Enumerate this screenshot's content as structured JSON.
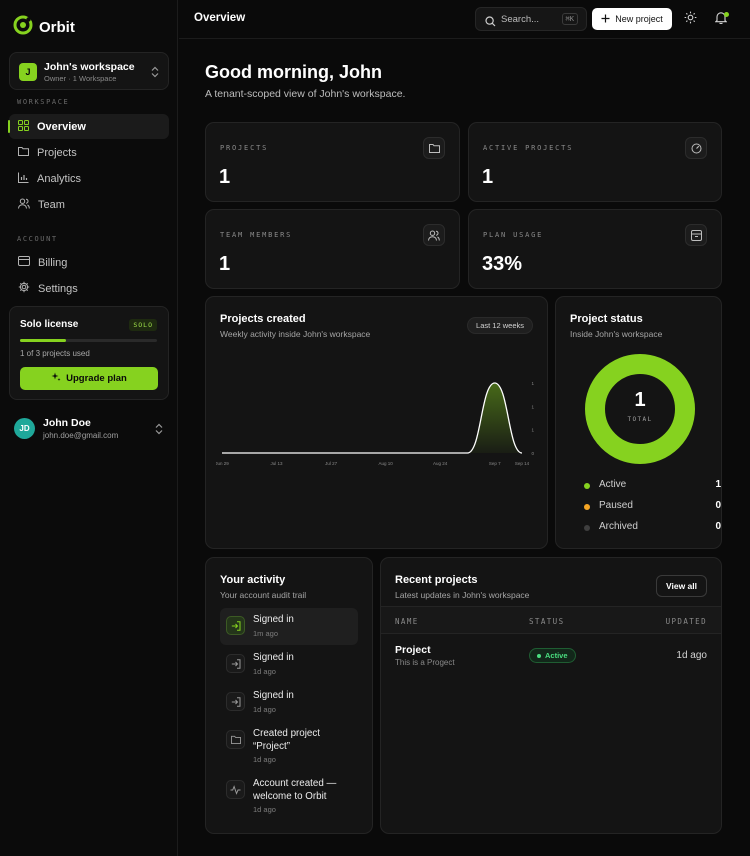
{
  "brand": {
    "name": "Orbit",
    "accent": "#86d21f"
  },
  "workspace": {
    "initial": "J",
    "name": "John's workspace",
    "meta": "Owner · 1 Workspace"
  },
  "sidebar": {
    "workspace_label": "WORKSPACE",
    "account_label": "ACCOUNT",
    "items": [
      {
        "label": "Overview",
        "icon": "grid-icon",
        "active": true
      },
      {
        "label": "Projects",
        "icon": "folder-icon"
      },
      {
        "label": "Analytics",
        "icon": "bar-chart-icon"
      },
      {
        "label": "Team",
        "icon": "users-icon"
      },
      {
        "label": "Billing",
        "icon": "credit-card-icon"
      },
      {
        "label": "Settings",
        "icon": "gear-icon"
      }
    ]
  },
  "license": {
    "title": "Solo license",
    "badge": "SOLO",
    "usage_text": "1 of 3 projects used",
    "usage_fraction": 0.333,
    "upgrade_label": "Upgrade plan"
  },
  "user": {
    "initials": "JD",
    "name": "John Doe",
    "email": "john.doe@gmail.com"
  },
  "topbar": {
    "title": "Overview",
    "search_placeholder": "Search...",
    "search_shortcut": "⌘K",
    "new_project_label": "New project"
  },
  "greeting": {
    "title": "Good morning, John",
    "subtitle": "A tenant-scoped view of John's workspace."
  },
  "stats": [
    {
      "label": "PROJECTS",
      "value": "1",
      "icon": "folder-icon"
    },
    {
      "label": "ACTIVE PROJECTS",
      "value": "1",
      "icon": "gauge-icon"
    },
    {
      "label": "TEAM MEMBERS",
      "value": "1",
      "icon": "users-icon"
    },
    {
      "label": "PLAN USAGE",
      "value": "33%",
      "icon": "archive-icon"
    }
  ],
  "projects_chart": {
    "title": "Projects created",
    "subtitle": "Weekly activity inside John's workspace",
    "range_label": "Last 12 weeks"
  },
  "chart_data": {
    "type": "area",
    "title": "Projects created",
    "subtitle": "Weekly activity inside John's workspace",
    "x": [
      "Jun 29",
      "Jul 06",
      "Jul 13",
      "Jul 20",
      "Jul 27",
      "Aug 03",
      "Aug 10",
      "Aug 17",
      "Aug 24",
      "Aug 31",
      "Sep 7",
      "Sep 14"
    ],
    "x_tick_labels": [
      "Jun 29",
      "Jul 13",
      "Jul 27",
      "Aug 10",
      "Aug 24",
      "Sep 7",
      "Sep 14"
    ],
    "y": [
      0,
      0,
      0,
      0,
      0,
      0,
      0,
      0,
      0,
      0,
      1,
      0
    ],
    "y_tick_labels": [
      "1",
      "1",
      "1",
      "0"
    ],
    "ylim": [
      0,
      1
    ],
    "grid": false,
    "color": "#ffffff"
  },
  "status_card": {
    "title": "Project status",
    "subtitle": "Inside John's workspace",
    "total_value": "1",
    "total_label": "TOTAL",
    "legend": [
      {
        "name": "Active",
        "value": "1",
        "color": "#86d21f"
      },
      {
        "name": "Paused",
        "value": "0",
        "color": "#f5a524"
      },
      {
        "name": "Archived",
        "value": "0",
        "color": "#3f3f3f"
      }
    ]
  },
  "activity": {
    "title": "Your activity",
    "subtitle": "Your account audit trail",
    "items": [
      {
        "title": "Signed in",
        "time": "1m ago",
        "icon": "sign-in-icon"
      },
      {
        "title": "Signed in",
        "time": "1d ago",
        "icon": "sign-in-icon"
      },
      {
        "title": "Signed in",
        "time": "1d ago",
        "icon": "sign-in-icon"
      },
      {
        "title_line1": "Created project",
        "title_line2": "“Project”",
        "time": "1d ago",
        "icon": "folder-icon"
      },
      {
        "title_line1": "Account created —",
        "title_line2": "welcome to Orbit",
        "time": "1d ago",
        "icon": "pulse-icon"
      }
    ]
  },
  "recent": {
    "title": "Recent projects",
    "subtitle": "Latest updates in John's workspace",
    "view_all_label": "View all",
    "columns": [
      "NAME",
      "STATUS",
      "UPDATED"
    ],
    "rows": [
      {
        "name": "Project",
        "description": "This is a Progect",
        "status": "Active",
        "updated": "1d ago"
      }
    ]
  }
}
